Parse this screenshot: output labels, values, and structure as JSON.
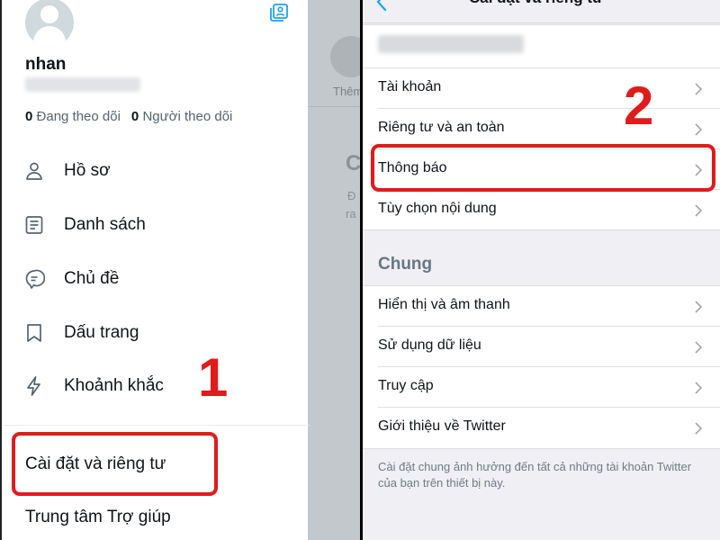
{
  "left": {
    "profile": {
      "username": "nhan",
      "following_count": "0",
      "following_label": "Đang theo dõi",
      "followers_count": "0",
      "followers_label": "Người theo dõi"
    },
    "menu": [
      {
        "label": "Hồ sơ",
        "icon": "person-icon"
      },
      {
        "label": "Danh sách",
        "icon": "list-icon"
      },
      {
        "label": "Chủ đề",
        "icon": "topics-icon"
      },
      {
        "label": "Dấu trang",
        "icon": "bookmark-icon"
      },
      {
        "label": "Khoảnh khắc",
        "icon": "lightning-icon"
      }
    ],
    "settings_label": "Cài đặt và riêng tư",
    "help_label": "Trung tâm Trợ giúp",
    "step_number": "1",
    "background": {
      "them_label": "Thêm",
      "c_letter": "C",
      "d_letter": "Đ",
      "ra_letter": "ra"
    }
  },
  "right": {
    "nav_title": "Cài đặt và riêng tư",
    "step_number": "2",
    "account_section": [
      {
        "label": "Tài khoản"
      },
      {
        "label": "Riêng tư và an toàn"
      },
      {
        "label": "Thông báo"
      },
      {
        "label": "Tùy chọn nội dung"
      }
    ],
    "general_header": "Chung",
    "general_section": [
      {
        "label": "Hiển thị và âm thanh"
      },
      {
        "label": "Sử dụng dữ liệu"
      },
      {
        "label": "Truy cập"
      },
      {
        "label": "Giới thiệu về Twitter"
      }
    ],
    "footnote": "Cài đặt chung ảnh hưởng đến tất cả những tài khoản Twitter của bạn trên thiết bị này."
  },
  "colors": {
    "highlight_red": "#e01b1b",
    "twitter_blue": "#1da1f2",
    "text_primary": "#0f1419",
    "text_secondary": "#536471"
  }
}
